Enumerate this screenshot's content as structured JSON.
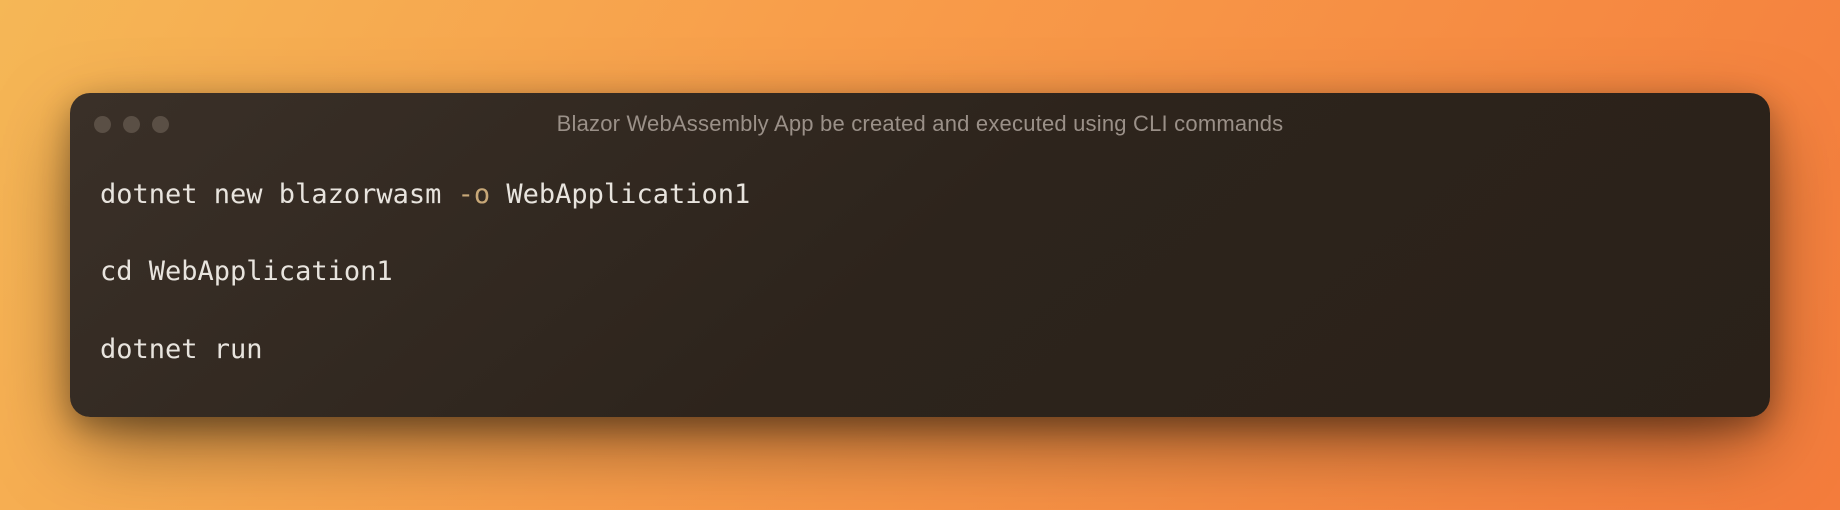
{
  "window": {
    "title": "Blazor WebAssembly App be created and executed using CLI commands"
  },
  "code": {
    "lines": [
      {
        "segments": [
          {
            "text": "dotnet new blazorwasm ",
            "class": ""
          },
          {
            "text": "-o",
            "class": "flag"
          },
          {
            "text": " WebApplication1",
            "class": ""
          }
        ]
      },
      {
        "segments": [
          {
            "text": "cd WebApplication1",
            "class": ""
          }
        ]
      },
      {
        "segments": [
          {
            "text": "dotnet run",
            "class": ""
          }
        ]
      }
    ]
  }
}
